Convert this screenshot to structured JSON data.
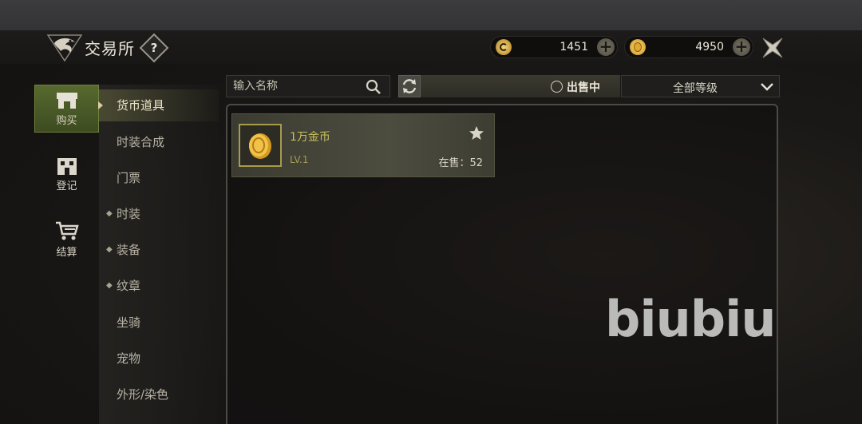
{
  "header": {
    "title": "交易所",
    "help_label": "?"
  },
  "currencies": [
    {
      "value": "1451",
      "plus": "+",
      "icon": "silver-coin-icon",
      "color": "#e8c25a"
    },
    {
      "value": "4950",
      "plus": "+",
      "icon": "gold-coin-icon",
      "color": "#f0c040"
    }
  ],
  "sidebar": [
    {
      "label": "购买",
      "icon": "shop-icon",
      "active": true
    },
    {
      "label": "登记",
      "icon": "building-icon",
      "active": false
    },
    {
      "label": "结算",
      "icon": "cart-icon",
      "active": false
    }
  ],
  "categories": [
    {
      "label": "货币道具",
      "dot": "",
      "active": true
    },
    {
      "label": "时装合成",
      "dot": ""
    },
    {
      "label": "门票",
      "dot": ""
    },
    {
      "label": "时装",
      "dot": "◆"
    },
    {
      "label": "装备",
      "dot": "◆"
    },
    {
      "label": "纹章",
      "dot": "◆"
    },
    {
      "label": "坐骑",
      "dot": ""
    },
    {
      "label": "宠物",
      "dot": ""
    },
    {
      "label": "外形/染色",
      "dot": ""
    }
  ],
  "search": {
    "placeholder": "输入名称"
  },
  "filter": {
    "on_sale_label": "出售中",
    "grade_label": "全部等级"
  },
  "items": [
    {
      "name": "1万金币",
      "level": "LV.1",
      "on_sale": "在售：52"
    }
  ],
  "watermark": "biubiu",
  "colors": {
    "accent_green": "#58692f",
    "item_name": "#c9c25a"
  }
}
